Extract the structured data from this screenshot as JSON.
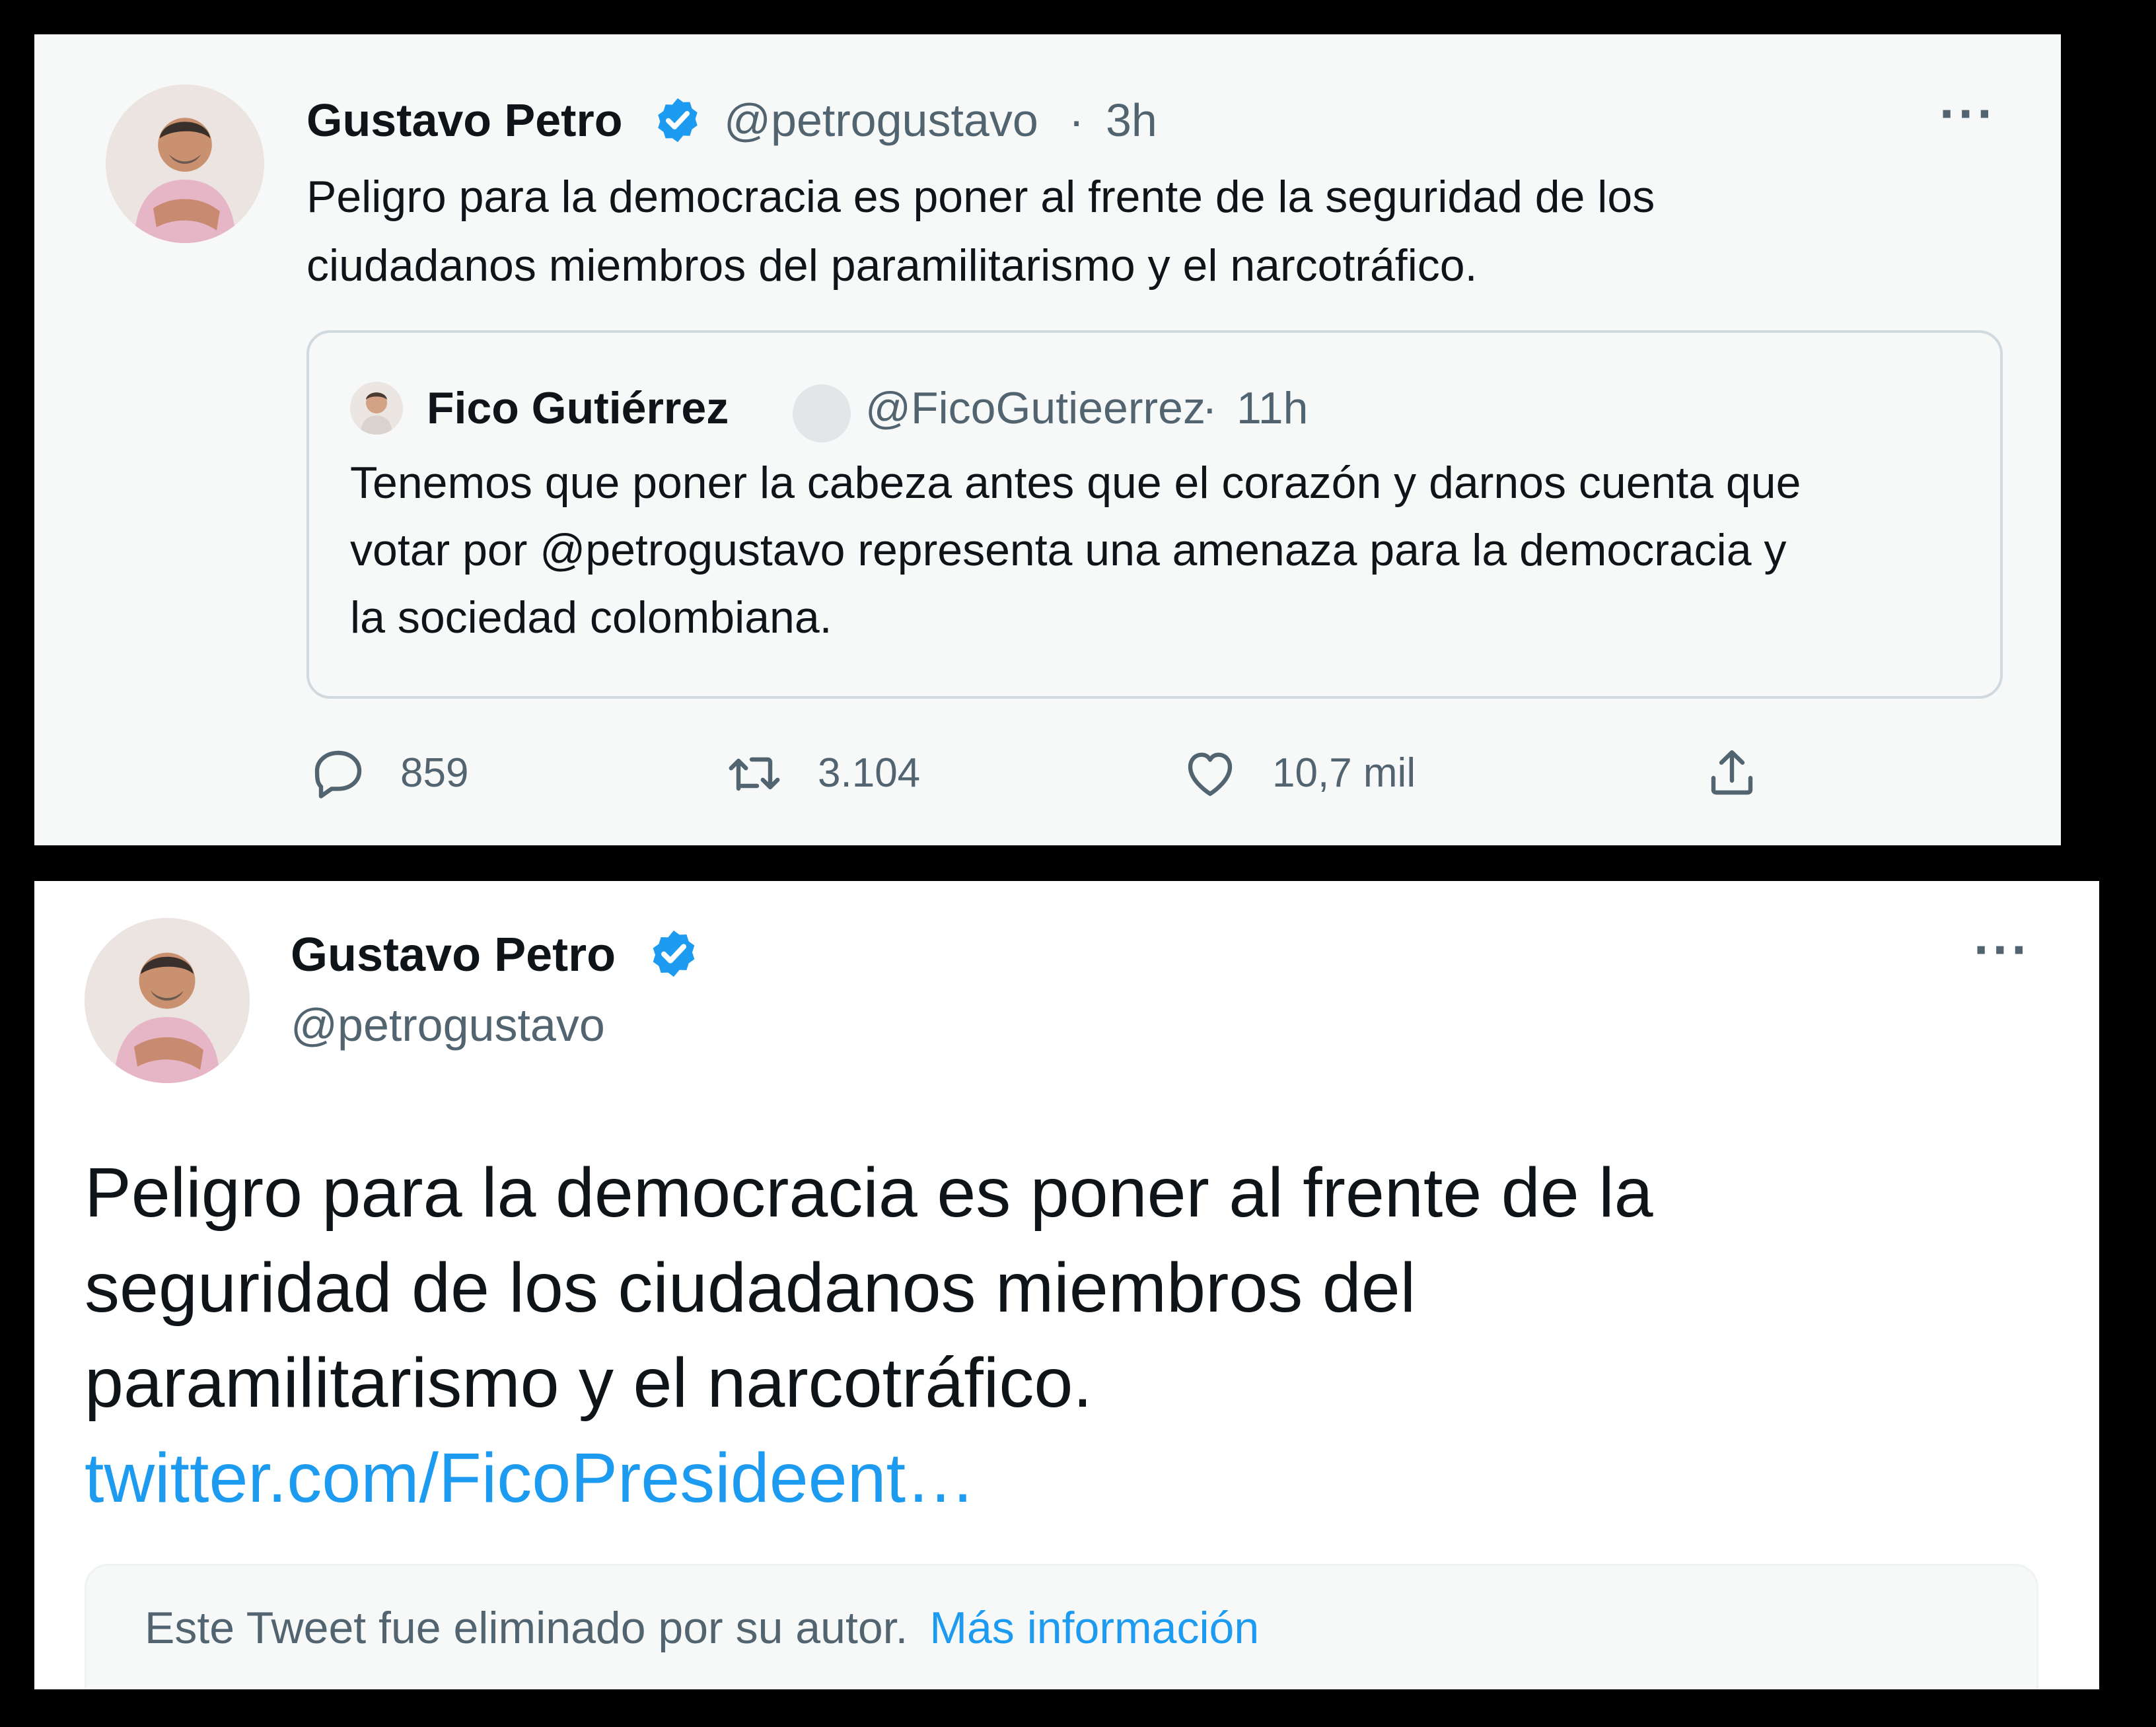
{
  "top_tweet": {
    "author": {
      "name": "Gustavo Petro",
      "handle": "@petrogustavo",
      "separator": "·",
      "time": "3h",
      "verified": true,
      "avatar_icon": "person-portrait-avatar"
    },
    "more_label": "···",
    "text_lines": [
      "Peligro para la democracia es poner al frente de la seguridad de los",
      "ciudadanos miembros del paramilitarismo y el narcotráfico."
    ],
    "quoted": {
      "name": "Fico Gutiérrez",
      "handle": "@FicoGutieerrez",
      "separator": "·",
      "time": "11h",
      "text_lines": [
        "Tenemos que poner la cabeza antes que el corazón y darnos cuenta que",
        "votar por @petrogustavo representa una amenaza para la democracia y",
        "la sociedad colombiana."
      ]
    },
    "actions": {
      "replies": "859",
      "retweets": "3.104",
      "likes": "10,7 mil",
      "icons": [
        "reply-icon",
        "retweet-icon",
        "like-icon",
        "share-icon"
      ]
    }
  },
  "bottom_tweet": {
    "author": {
      "name": "Gustavo Petro",
      "handle": "@petrogustavo",
      "verified": true
    },
    "more_label": "···",
    "text_lines": [
      "Peligro para la democracia es poner al frente de la",
      "seguridad de los ciudadanos miembros del",
      "paramilitarismo y el narcotráfico."
    ],
    "link": "twitter.com/FicoPresideent…",
    "deleted_notice": "Este Tweet fue eliminado por su autor.",
    "deleted_link": "Más información"
  },
  "colors": {
    "accent": "#1d9bf0",
    "text": "#0f1419",
    "muted": "#536471",
    "border": "#cfd9de",
    "panel_grey": "#f7f9f9"
  }
}
